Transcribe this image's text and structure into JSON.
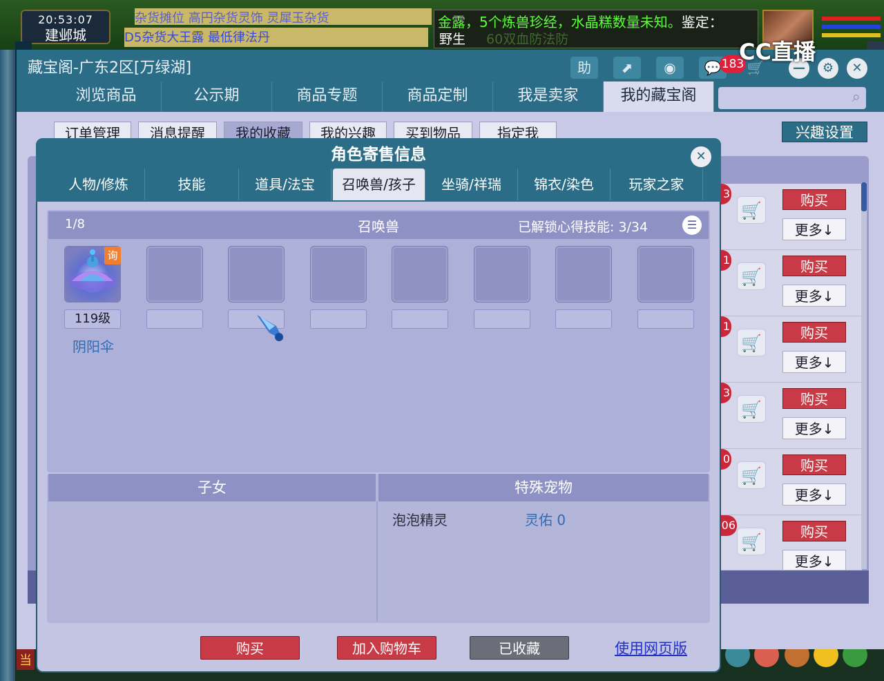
{
  "game": {
    "time": "20:53:07",
    "city": "建邺城",
    "ticker_top": "杂货摊位 高円杂货灵饰 灵犀玉杂货",
    "ticker_bottom": "D5杂货大王露 最低律法丹",
    "message_line1_a": "金露，",
    "message_line1_b": "5个炼兽珍经，水晶糕数量未知。",
    "message_line1_c": "鉴定：",
    "message_line2_a": "野生",
    "message_line2_b": "60双血防法防",
    "chat_label": "当"
  },
  "watermark": "CC直播",
  "store": {
    "title": "藏宝阁-广东2区[万绿湖]",
    "help_icon": "助",
    "cart_badge": "183",
    "nav": [
      "浏览商品",
      "公示期",
      "商品专题",
      "商品定制",
      "我是卖家",
      "我的藏宝阁"
    ],
    "active_nav": "我的藏宝阁",
    "sub_tabs": [
      "订单管理",
      "消息提醒",
      "我的收藏",
      "我的兴趣",
      "买到物品",
      "指定我"
    ],
    "active_sub_tab": "我的收藏",
    "interest_settings": "兴趣设置",
    "rows": [
      {
        "num": "3",
        "buy": "购买",
        "more": "更多↓"
      },
      {
        "num": "1",
        "buy": "购买",
        "more": "更多↓"
      },
      {
        "num": "1",
        "buy": "购买",
        "more": "更多↓"
      },
      {
        "num": "3",
        "buy": "购买",
        "more": "更多↓"
      },
      {
        "num": "0",
        "buy": "购买",
        "more": "更多↓"
      },
      {
        "num": "06",
        "buy": "购买",
        "more": "更多↓"
      }
    ]
  },
  "modal": {
    "title": "角色寄售信息",
    "tabs": [
      "人物/修炼",
      "技能",
      "道具/法宝",
      "召唤兽/孩子",
      "坐骑/祥瑞",
      "锦衣/染色",
      "玩家之家"
    ],
    "active_tab": "召唤兽/孩子",
    "pets": {
      "count": "1/8",
      "title": "召唤兽",
      "skills_label": "已解锁心得技能: 3/34",
      "query_badge": "询",
      "first_level": "119级",
      "first_name": "阴阳伞"
    },
    "children_title": "子女",
    "special_title": "特殊宠物",
    "special_pet": {
      "name": "泡泡精灵",
      "value": "灵佑 0"
    },
    "buttons": {
      "buy": "购买",
      "add_cart": "加入购物车",
      "favorited": "已收藏",
      "web_version": "使用网页版"
    }
  },
  "colors": {
    "header_teal": "#2b6d86",
    "panel_lavender": "#c3c5e3",
    "buy_red": "#c83a45",
    "favorited_gray": "#6b6e78",
    "link_blue": "#2030c0"
  }
}
